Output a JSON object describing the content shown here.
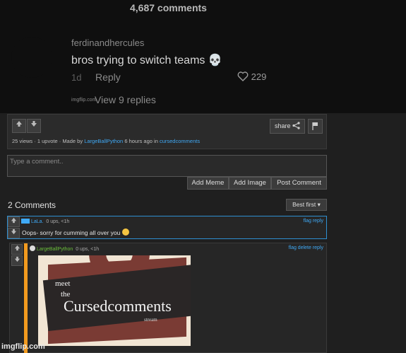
{
  "meme": {
    "comment_count": "4,687 comments",
    "username": "ferdinandhercules",
    "comment_text": "bros trying to switch teams 💀",
    "time": "1d",
    "reply_label": "Reply",
    "likes": "229",
    "view_replies": "View 9 replies",
    "watermark": "imgflip.com"
  },
  "post": {
    "views": "25 views",
    "upvotes": "1 upvote",
    "made_by_prefix": "Made by",
    "author": "LargeBallPython",
    "time_text": "6 hours ago in",
    "stream": "cursedcomments",
    "share_label": "share"
  },
  "composer": {
    "placeholder": "Type a comment..",
    "add_meme": "Add Meme",
    "add_image": "Add Image",
    "post_comment": "Post Comment"
  },
  "comments": {
    "title": "2 Comments",
    "sort_label": "Best first",
    "items": [
      {
        "username": "LaLa.",
        "meta": "0 ups, <1h",
        "text": "Oops- sorry for cumming all over you",
        "actions": "flag reply"
      },
      {
        "username": "LargeBallPython",
        "meta": "0 ups, <1h",
        "actions": "flag delete reply",
        "image": {
          "meet": "meet",
          "the": "the",
          "title": "Cursedcomments",
          "subtitle": "stream"
        }
      }
    ]
  },
  "footer": {
    "watermark": "imgflip.com"
  }
}
